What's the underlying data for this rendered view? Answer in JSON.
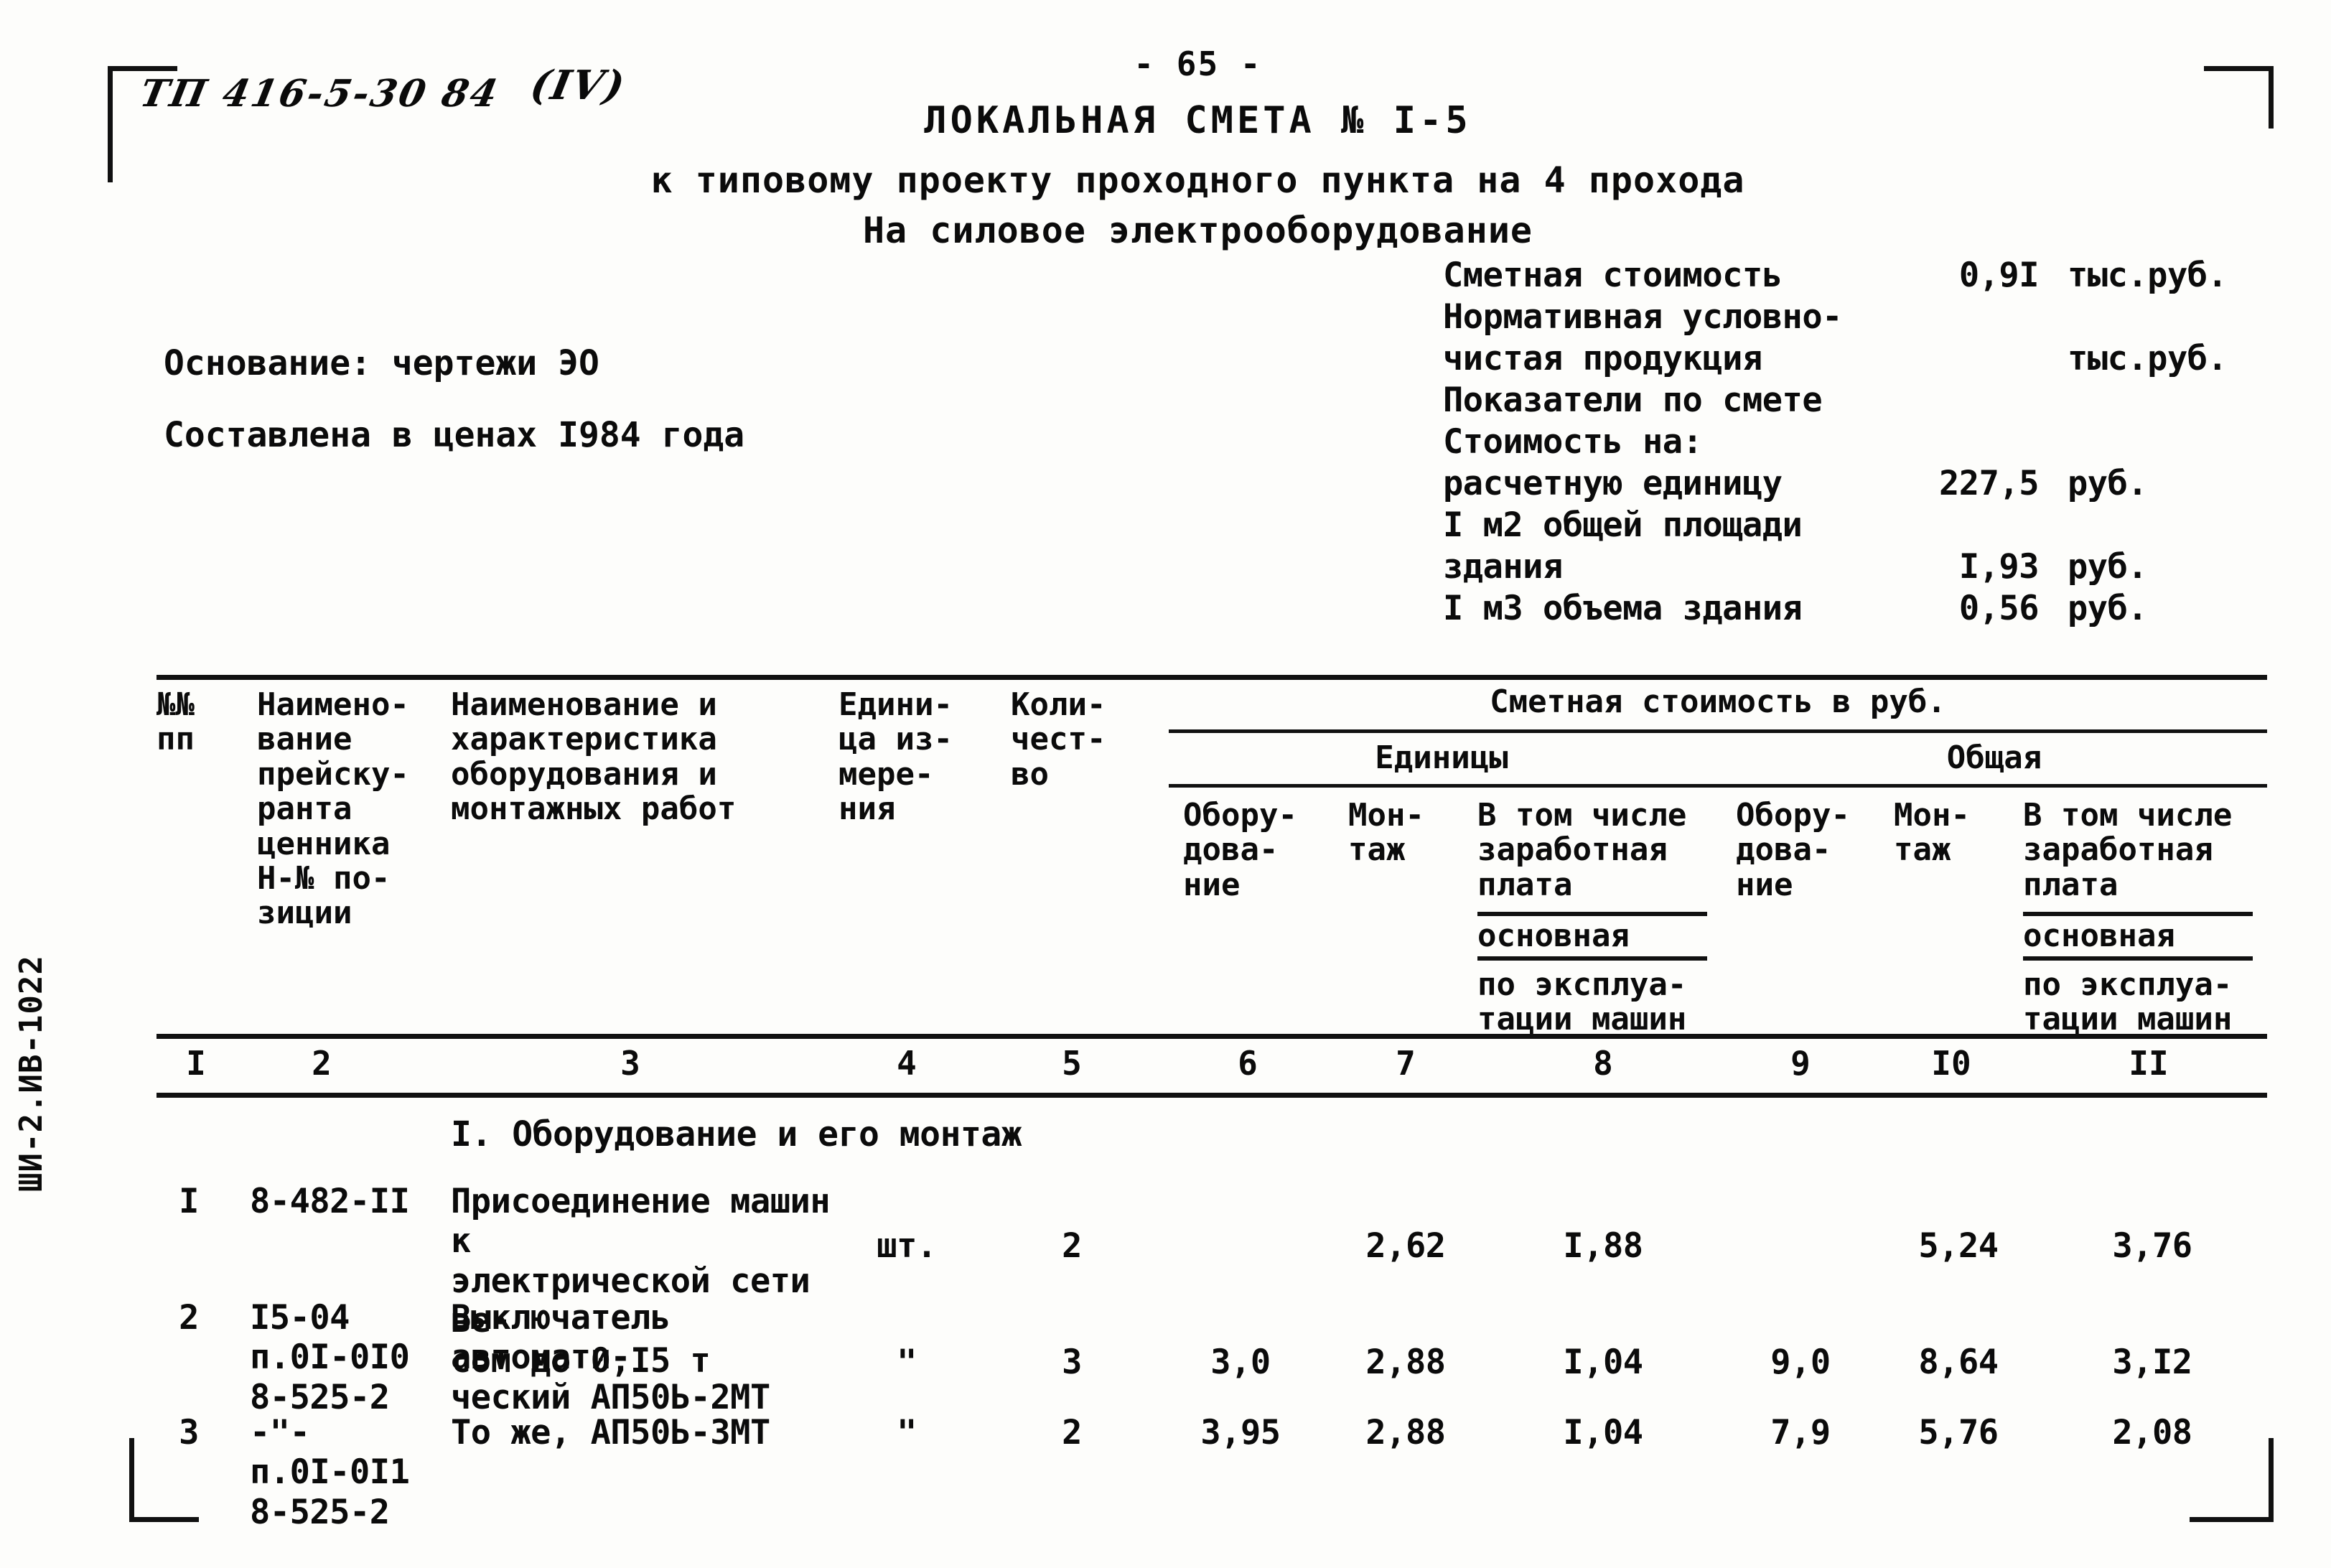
{
  "annotation": {
    "project_code": "ТП 416-5-30 84",
    "roman_mark": "(IV)"
  },
  "side_stamp": "ШИ-2.ИВ-1022",
  "page_number": "- 65 -",
  "header": {
    "title": "ЛОКАЛЬНАЯ СМЕТА № I-5",
    "subtitle_1": "к типовому проекту проходного пункта на 4 прохода",
    "subtitle_2": "На силовое электрооборудование"
  },
  "left_info": {
    "basis": "Основание: чертежи ЭО",
    "prices": "Составлена в ценах I984 года"
  },
  "summary": [
    {
      "label": "Сметная стоимость",
      "value": "0,9I",
      "unit": "тыс.руб."
    },
    {
      "label": "Нормативная условно-",
      "value": "",
      "unit": ""
    },
    {
      "label": "чистая продукция",
      "value": "",
      "unit": "тыс.руб."
    },
    {
      "label": "Показатели по смете",
      "value": "",
      "unit": ""
    },
    {
      "label": "Стоимость на:",
      "value": "",
      "unit": ""
    },
    {
      "label": "расчетную единицу",
      "value": "227,5",
      "unit": "руб."
    },
    {
      "label": "I м2 общей площади",
      "value": "",
      "unit": ""
    },
    {
      "label": "здания",
      "value": "I,93",
      "unit": "руб."
    },
    {
      "label": "I м3 объема здания",
      "value": "0,56",
      "unit": "руб."
    }
  ],
  "table": {
    "spanning_header": "Сметная стоимость в руб.",
    "group_unit": "Единицы",
    "group_total": "Общая",
    "headers": {
      "col1": "№№\nпп",
      "col2": "Наимено-\nвание\nпрейску-\nранта\nценника\nН-№ по-\nзиции",
      "col3": "Наименование и\nхарактеристика\nоборудования и\nмонтажных работ",
      "col4": "Едини-\nца из-\nмере-\nния",
      "col5": "Коли-\nчест-\nво",
      "col6": "Обору-\nдова-\nние",
      "col7": "Мон-\nтаж",
      "col8_a": "В том числе\nзаработная\nплата",
      "col8_b": "основная",
      "col8_c": "по эксплуа-\nтации машин",
      "col9": "Обору-\nдова-\nние",
      "col10": "Мон-\nтаж",
      "col11_a": "В том числе\nзаработная\nплата",
      "col11_b": "основная",
      "col11_c": "по эксплуа-\nтации машин"
    },
    "column_numbers": [
      "I",
      "2",
      "3",
      "4",
      "5",
      "6",
      "7",
      "8",
      "9",
      "I0",
      "II"
    ],
    "section_title": "I. Оборудование и его монтаж",
    "rows": [
      {
        "no": "I",
        "price_ref": "8-482-II",
        "description": "Присоединение машин к\nэлектрической сети ве-\nсом до 0,I5 т",
        "unit": "шт.",
        "qty": "2",
        "unit_equipment": "",
        "unit_assembly": "2,62",
        "unit_wages": "I,88",
        "total_equipment": "",
        "total_assembly": "5,24",
        "total_wages": "3,76"
      },
      {
        "no": "2",
        "price_ref": "I5-04\nп.0I-0I0\n8-525-2",
        "description": "Выключатель автомати-\nческий АП50Ь-2МТ",
        "unit": "\"",
        "qty": "3",
        "unit_equipment": "3,0",
        "unit_assembly": "2,88",
        "unit_wages": "I,04",
        "total_equipment": "9,0",
        "total_assembly": "8,64",
        "total_wages": "3,I2"
      },
      {
        "no": "3",
        "price_ref": "-\"-\nп.0I-0I1\n8-525-2",
        "description": "То же, АП50Ь-3МТ",
        "unit": "\"",
        "qty": "2",
        "unit_equipment": "3,95",
        "unit_assembly": "2,88",
        "unit_wages": "I,04",
        "total_equipment": "7,9",
        "total_assembly": "5,76",
        "total_wages": "2,08"
      }
    ]
  }
}
